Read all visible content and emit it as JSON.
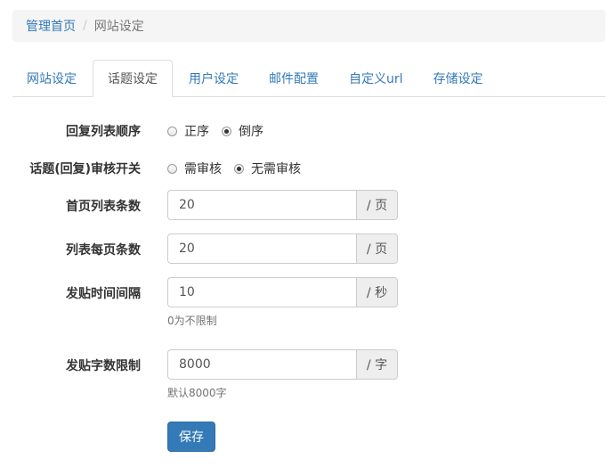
{
  "breadcrumb": {
    "home": "管理首页",
    "separator": "/",
    "current": "网站设定"
  },
  "tabs": [
    {
      "label": "网站设定",
      "active": false
    },
    {
      "label": "话题设定",
      "active": true
    },
    {
      "label": "用户设定",
      "active": false
    },
    {
      "label": "邮件配置",
      "active": false
    },
    {
      "label": "自定义url",
      "active": false
    },
    {
      "label": "存储设定",
      "active": false
    }
  ],
  "form": {
    "reply_order": {
      "label": "回复列表顺序",
      "options": [
        {
          "label": "正序",
          "checked": false
        },
        {
          "label": "倒序",
          "checked": true
        }
      ]
    },
    "review_switch": {
      "label": "话题(回复)审核开关",
      "options": [
        {
          "label": "需审核",
          "checked": false
        },
        {
          "label": "无需审核",
          "checked": true
        }
      ]
    },
    "home_list_count": {
      "label": "首页列表条数",
      "value": "20",
      "unit": "/ 页"
    },
    "per_page_count": {
      "label": "列表每页条数",
      "value": "20",
      "unit": "/ 页"
    },
    "post_interval": {
      "label": "发贴时间间隔",
      "value": "10",
      "unit": "/ 秒",
      "help": "0为不限制"
    },
    "post_char_limit": {
      "label": "发贴字数限制",
      "value": "8000",
      "unit": "/ 字",
      "help": "默认8000字"
    },
    "save_label": "保存"
  }
}
